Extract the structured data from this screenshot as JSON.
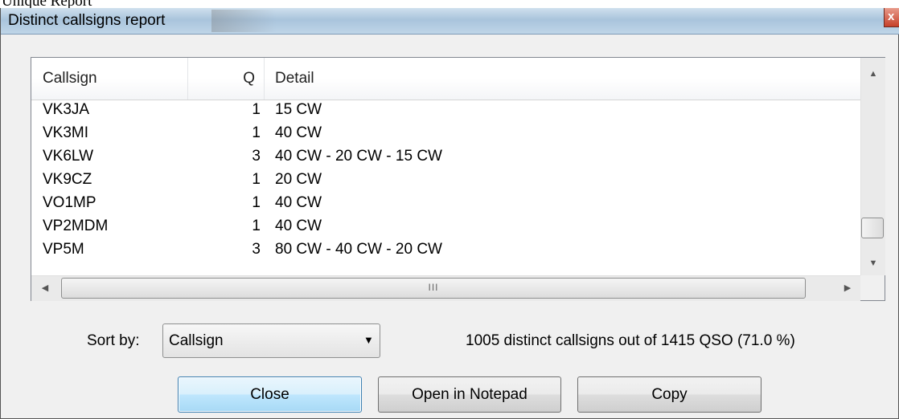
{
  "page": {
    "caption": "Unique Report"
  },
  "window": {
    "title": "Distinct callsigns report",
    "close_glyph": "x"
  },
  "list": {
    "columns": {
      "callsign": "Callsign",
      "q": "Q",
      "detail": "Detail"
    },
    "rows": [
      {
        "callsign": "VK3JA",
        "q": "1",
        "detail": "15 CW"
      },
      {
        "callsign": "VK3MI",
        "q": "1",
        "detail": "40 CW"
      },
      {
        "callsign": "VK6LW",
        "q": "3",
        "detail": "40 CW - 20 CW - 15 CW"
      },
      {
        "callsign": "VK9CZ",
        "q": "1",
        "detail": "20 CW"
      },
      {
        "callsign": "VO1MP",
        "q": "1",
        "detail": "40 CW"
      },
      {
        "callsign": "VP2MDM",
        "q": "1",
        "detail": "40 CW"
      },
      {
        "callsign": "VP5M",
        "q": "3",
        "detail": "80 CW - 40 CW - 20 CW"
      }
    ],
    "vscroll": {
      "up": "▲",
      "down": "▼"
    },
    "hscroll": {
      "left": "◀",
      "right": "▶",
      "grip": "III"
    }
  },
  "sort": {
    "label": "Sort by:",
    "value": "Callsign",
    "caret": "▼"
  },
  "summary": "1005 distinct callsigns out of 1415 QSO (71.0 %)",
  "buttons": {
    "close": "Close",
    "notepad": "Open in Notepad",
    "copy": "Copy"
  }
}
